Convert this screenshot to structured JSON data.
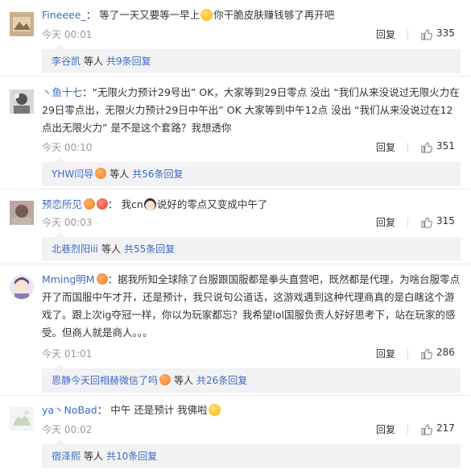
{
  "comments": [
    {
      "user": "Fineeee_",
      "colon": "：",
      "text_before": "等了一天又要等一早上",
      "text_after": "你干脆皮肤赚钱够了再开吧",
      "time": "今天 00:01",
      "reply_label": "回复",
      "likes": "335",
      "replies_user": "李谷凯",
      "replies_etc": "等人",
      "replies_total": "共9条回复"
    },
    {
      "user": "丶鱼十七",
      "colon": "：",
      "text": "“无限火力预计29号出” OK，大家等到29日零点 没出 “我们从来没说过无限火力在29日零点出，无限火力预计29日中午出” OK 大家等到中午12点 没出 “我们从来没说过在12点出无限火力” 是不是这个套路？我想透你",
      "time": "今天 00:10",
      "reply_label": "回复",
      "likes": "351",
      "replies_user": "YHW闫导",
      "replies_etc": "等人",
      "replies_total": "共56条回复"
    },
    {
      "user": "预恋所见",
      "colon": "：",
      "text_before": "我cn",
      "text_after": "说好的零点又变成中午了",
      "time": "今天 00:03",
      "reply_label": "回复",
      "likes": "315",
      "replies_user": "北巷烈阳iii",
      "replies_etc": "等人",
      "replies_total": "共55条回复"
    },
    {
      "user": "Mming明M",
      "colon": "：",
      "text": "据我所知全球除了台服跟国服都是拳头直营吧，既然都是代理，为啥台服零点开了而国服中午才开，还是预计，我只说句公道话，这游戏遇到这种代理商真的是白瞎这个游戏了。跟上次ig夺冠一样，你以为玩家都忘？我希望lol国服负责人好好思考下，站在玩家的感受。但商人就是商人。。。",
      "time": "今天 01:01",
      "reply_label": "回复",
      "likes": "286",
      "replies_user": "恩静今天回相赫微信了吗",
      "replies_etc": "等人",
      "replies_total": "共26条回复"
    },
    {
      "user": "ya丶NoBad",
      "colon": "：",
      "text": "中午 还是预计 我佛啦",
      "time": "今天 00:02",
      "reply_label": "回复",
      "likes": "217",
      "replies_user": "宿泽熙",
      "replies_etc": "等人",
      "replies_total": "共10条回复"
    }
  ],
  "colors": {
    "username": "#eb7350",
    "link": "#3c6bc0",
    "reply_bg": "#f2f2f5",
    "meta": "#999999"
  },
  "icons": {
    "like": "thumbs-up-icon",
    "badge": "user-badge-icon",
    "emoji": "emoji-icon"
  }
}
